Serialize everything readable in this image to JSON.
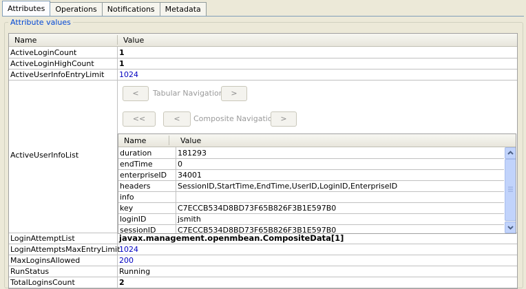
{
  "tabs": [
    "Attributes",
    "Operations",
    "Notifications",
    "Metadata"
  ],
  "group_title": "Attribute values",
  "columns": {
    "name": "Name",
    "value": "Value"
  },
  "rows_top": [
    {
      "name": "ActiveLoginCount",
      "value": "1",
      "style": "bold"
    },
    {
      "name": "ActiveLoginHighCount",
      "value": "1",
      "style": "bold"
    },
    {
      "name": "ActiveUserInfoEntryLimit",
      "value": "1024",
      "style": "num"
    }
  ],
  "composite_row": {
    "name": "ActiveUserInfoList",
    "tabular_nav_label": "Tabular Navigation",
    "composite_nav_label": "Composite Navigation",
    "prev_label": "<",
    "next_label": ">",
    "first_label": "<<",
    "inner_columns": {
      "name": "Name",
      "value": "Value"
    },
    "inner_rows": [
      {
        "name": "duration",
        "value": "181293"
      },
      {
        "name": "endTime",
        "value": "0"
      },
      {
        "name": "enterpriseID",
        "value": "34001"
      },
      {
        "name": "headers",
        "value": "SessionID,StartTime,EndTime,UserID,LoginID,EnterpriseID"
      },
      {
        "name": "info",
        "value": ""
      },
      {
        "name": "key",
        "value": "C7ECCB534D8BD73F65B826F3B1E597B0"
      },
      {
        "name": "loginID",
        "value": "jsmith"
      },
      {
        "name": "sessionID",
        "value": "C7ECCB534D8BD73F65B826F3B1E597B0"
      }
    ]
  },
  "rows_bottom": [
    {
      "name": "LoginAttemptList",
      "value": "javax.management.openmbean.CompositeData[1]",
      "style": "boldbig"
    },
    {
      "name": "LoginAttemptsMaxEntryLimit",
      "value": "1024",
      "style": "num"
    },
    {
      "name": "MaxLoginsAllowed",
      "value": "200",
      "style": "num"
    },
    {
      "name": "RunStatus",
      "value": "Running",
      "style": ""
    },
    {
      "name": "TotalLoginsCount",
      "value": "2",
      "style": "bold"
    }
  ]
}
